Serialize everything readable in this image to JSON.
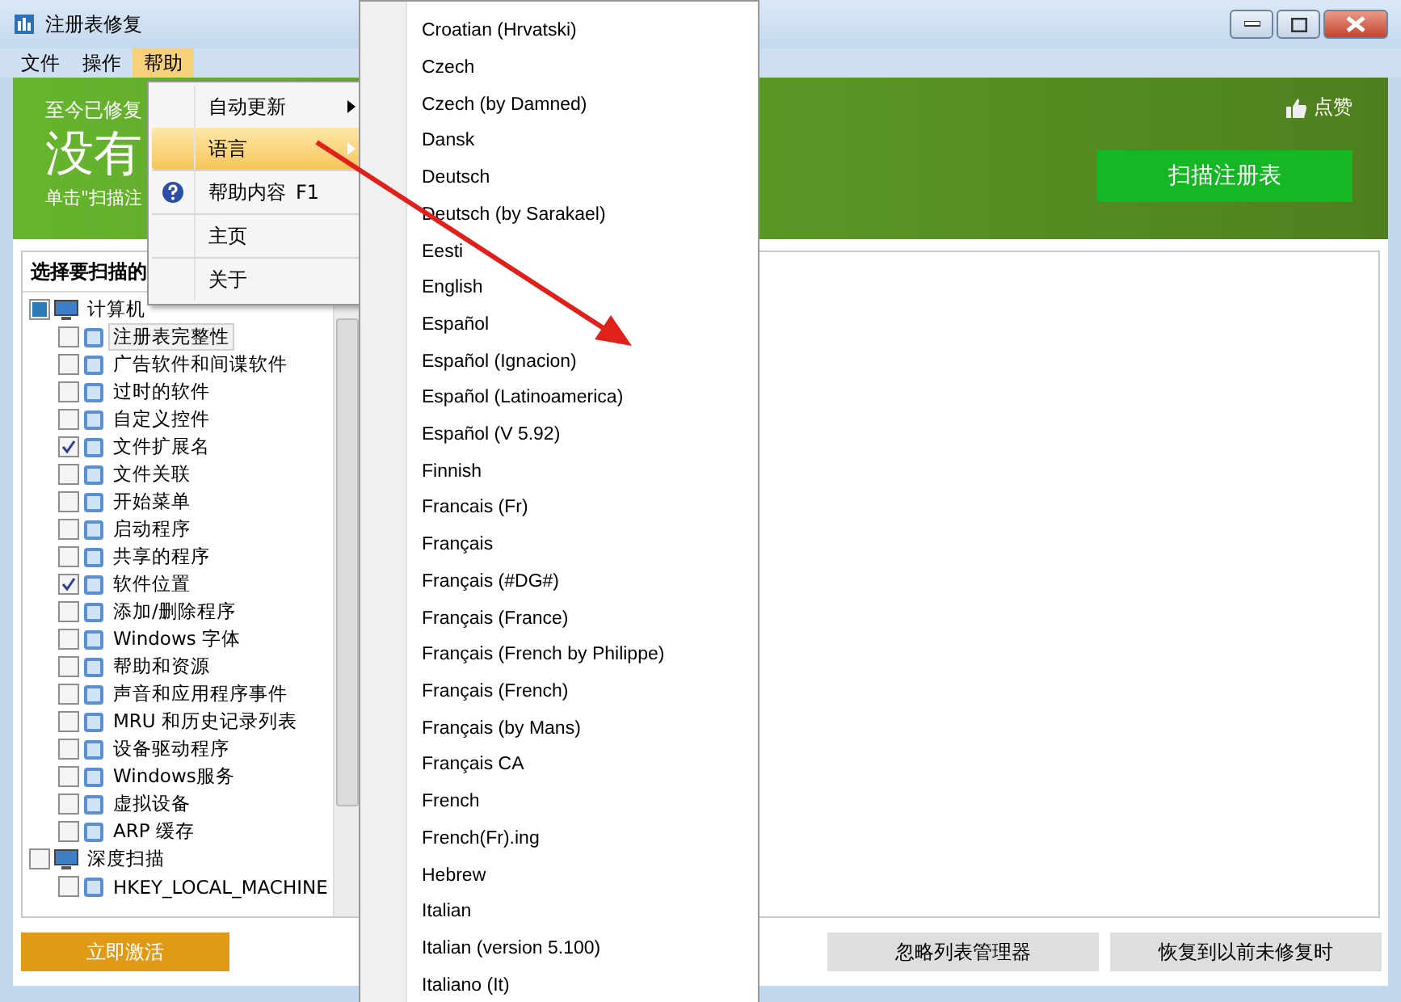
{
  "window": {
    "title": "注册表修复"
  },
  "menubar": [
    {
      "label": "文件",
      "selected": false
    },
    {
      "label": "操作",
      "selected": false
    },
    {
      "label": "帮助",
      "selected": true
    }
  ],
  "banner": {
    "status_line": "至今已修复",
    "headline": "没有",
    "hint": "单击\"扫描注",
    "like_link": "点赞",
    "scan_button": "扫描注册表"
  },
  "scan_panel": {
    "title": "选择要扫描的"
  },
  "tree": {
    "items": [
      {
        "label": "计算机",
        "checked": false,
        "partial": true,
        "selected": false,
        "children": [
          {
            "label": "注册表完整性",
            "checked": false,
            "partial": false,
            "selected": true
          },
          {
            "label": "广告软件和间谍软件",
            "checked": false,
            "partial": false,
            "selected": false
          },
          {
            "label": "过时的软件",
            "checked": false,
            "partial": false,
            "selected": false
          },
          {
            "label": "自定义控件",
            "checked": false,
            "partial": false,
            "selected": false
          },
          {
            "label": "文件扩展名",
            "checked": true,
            "partial": false,
            "selected": false
          },
          {
            "label": "文件关联",
            "checked": false,
            "partial": false,
            "selected": false
          },
          {
            "label": "开始菜单",
            "checked": false,
            "partial": false,
            "selected": false
          },
          {
            "label": "启动程序",
            "checked": false,
            "partial": false,
            "selected": false
          },
          {
            "label": "共享的程序",
            "checked": false,
            "partial": false,
            "selected": false
          },
          {
            "label": "软件位置",
            "checked": true,
            "partial": false,
            "selected": false
          },
          {
            "label": "添加/删除程序",
            "checked": false,
            "partial": false,
            "selected": false
          },
          {
            "label": "Windows 字体",
            "checked": false,
            "partial": false,
            "selected": false
          },
          {
            "label": "帮助和资源",
            "checked": false,
            "partial": false,
            "selected": false
          },
          {
            "label": "声音和应用程序事件",
            "checked": false,
            "partial": false,
            "selected": false
          },
          {
            "label": "MRU 和历史记录列表",
            "checked": false,
            "partial": false,
            "selected": false
          },
          {
            "label": "设备驱动程序",
            "checked": false,
            "partial": false,
            "selected": false
          },
          {
            "label": "Windows服务",
            "checked": false,
            "partial": false,
            "selected": false
          },
          {
            "label": "虚拟设备",
            "checked": false,
            "partial": false,
            "selected": false
          },
          {
            "label": "ARP 缓存",
            "checked": false,
            "partial": false,
            "selected": false
          }
        ]
      },
      {
        "label": "深度扫描",
        "checked": false,
        "partial": false,
        "selected": false,
        "children": [
          {
            "label": "HKEY_LOCAL_MACHINE",
            "checked": false,
            "partial": false,
            "selected": false
          }
        ]
      }
    ]
  },
  "bottom_buttons": {
    "activate": "立即激活",
    "ignore_list": "忽略列表管理器",
    "restore": "恢复到以前未修复时"
  },
  "help_menu": [
    {
      "label": "自动更新",
      "kind": "submenu",
      "selected": false
    },
    {
      "label": "语言",
      "kind": "submenu",
      "selected": true
    },
    {
      "label": "帮助内容",
      "shortcut": "F1",
      "kind": "help",
      "selected": false
    },
    {
      "label": "主页",
      "kind": "plain",
      "selected": false
    },
    {
      "label": "关于",
      "kind": "plain",
      "selected": false
    }
  ],
  "language_menu": [
    "Croatian (Hrvatski)",
    "Czech",
    "Czech (by Damned)",
    "Dansk",
    "Deutsch",
    "Deutsch (by Sarakael)",
    "Eesti",
    "English",
    "Español",
    "Español (Ignacion)",
    "Español (Latinoamerica)",
    "Español (V 5.92)",
    "Finnish",
    "Francais (Fr)",
    "Français",
    "Français (#DG#)",
    "Français (France)",
    "Français (French by Philippe)",
    "Français (French)",
    "Français (by Mans)",
    "Français CA",
    "French",
    "French(Fr).ing",
    "Hebrew",
    "Italian",
    "Italian (version 5.100)",
    "Italiano (It)"
  ]
}
